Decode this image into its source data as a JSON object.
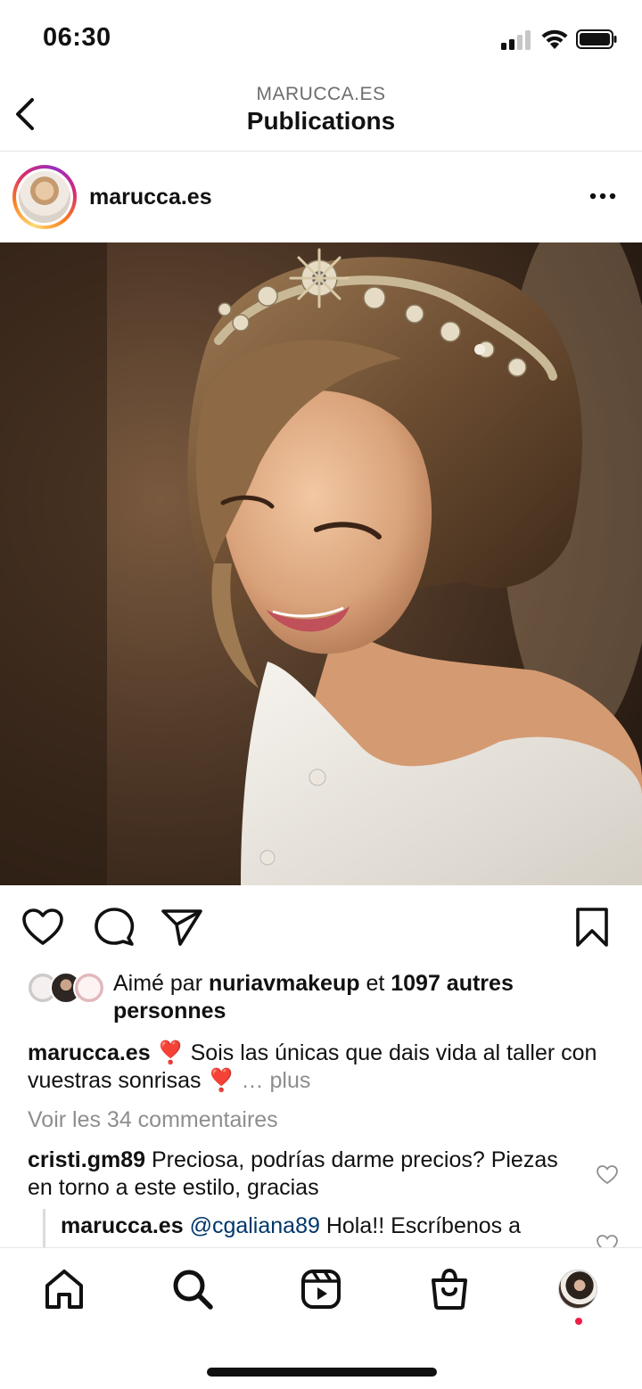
{
  "status_bar": {
    "time": "06:30"
  },
  "header": {
    "account": "MARUCCA.ES",
    "title": "Publications"
  },
  "post": {
    "username": "marucca.es",
    "likes": {
      "prefix": "Aimé par ",
      "liker": "nuriavmakeup",
      "middle": " et ",
      "count_text": "1097 autres personnes"
    },
    "caption": {
      "username": "marucca.es",
      "text_1": " ❣️ Sois las únicas que dais vida al taller con vuestras sonrisas ❣️",
      "ellipsis": " … ",
      "more": "plus"
    },
    "view_comments": "Voir les 34 commentaires",
    "comments": [
      {
        "username": "cristi.gm89",
        "text": " Preciosa, podrías darme precios? Piezas en torno a este estilo, gracias"
      }
    ],
    "reply": {
      "username": "marucca.es",
      "mention": "@cgaliana89",
      "text": " Hola!! Escríbenos a"
    }
  },
  "icons": {
    "back": "chevron-left-icon",
    "more": "more-horizontal-icon",
    "like": "heart-icon",
    "comment": "comment-icon",
    "share": "send-icon",
    "save": "bookmark-icon",
    "tabs": [
      "home-icon",
      "search-icon",
      "reels-icon",
      "shop-icon",
      "profile-avatar"
    ]
  },
  "colors": {
    "notification_dot": "#ed1f45",
    "link": "#00376b",
    "muted": "#8e8e8e"
  }
}
